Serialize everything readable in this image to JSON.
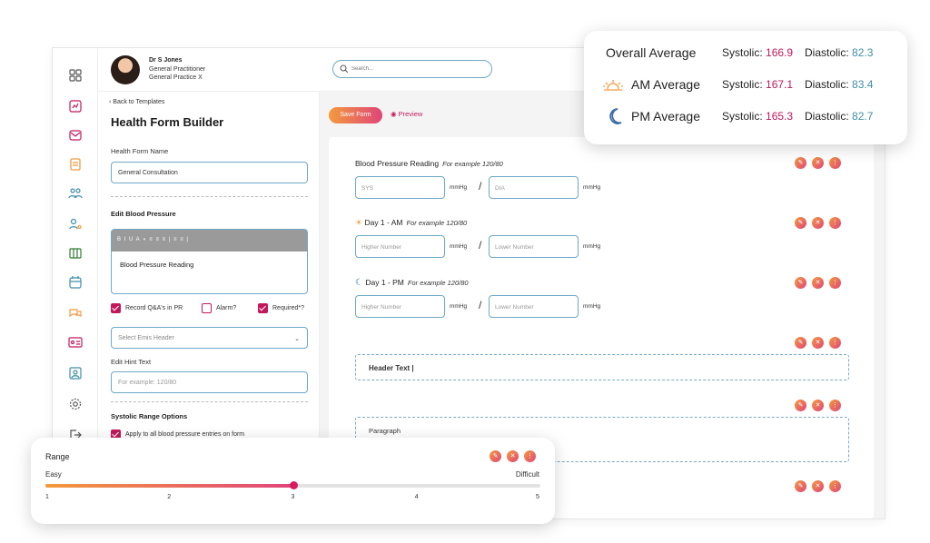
{
  "topbar": {
    "doctor_name": "Dr S Jones",
    "doctor_role": "General Practitioner",
    "doctor_practice": "General Practice X",
    "search_placeholder": "Search..."
  },
  "sidebar_icons": [
    "grid-icon",
    "chart-icon",
    "envelope-icon",
    "note-icon",
    "people-icon",
    "user-settings-icon",
    "columns-icon",
    "calendar-icon",
    "chat-icon",
    "id-card-icon",
    "contact-icon",
    "gear-icon",
    "logout-icon"
  ],
  "left_panel": {
    "back_link": "Back to Templates",
    "title": "Health Form Builder",
    "form_name_label": "Health Form Name",
    "form_name_value": "General Consultation",
    "edit_bp_label": "Edit Blood Pressure",
    "rte_toolbar": "B  I  U  A  ◖  ≡  ≡  ≡  |  ≡  ≡  |",
    "rte_text": "Blood Pressure Reading",
    "checkbox_record": "Record Q&A's in PR",
    "checkbox_alarm": "Alarm?",
    "checkbox_required": "Required*?",
    "emis_placeholder": "Select Emis Header",
    "hint_label": "Edit Hint Text",
    "hint_placeholder": "For example: 120/80",
    "systolic_label": "Systolic Range Options",
    "apply_all_label": "Apply to all blood pressure entries on form"
  },
  "toolbar": {
    "save_label": "Save Form",
    "preview_label": "Preview"
  },
  "canvas": {
    "bp_title": "Blood Pressure Reading",
    "bp_example": "For example 120/80",
    "sys_placeholder": "SYS",
    "dia_placeholder": "DIA",
    "unit": "mmHg",
    "slash": "/",
    "day_am_title": "Day 1 - AM",
    "day_pm_title": "Day 1 - PM",
    "higher_placeholder": "Higher Number",
    "lower_placeholder": "Lower Number",
    "header_text": "Header Text |",
    "paragraph_text": "Paragraph"
  },
  "averages": {
    "rows": [
      {
        "label": "Overall Average",
        "systolic_label": "Systolic:",
        "systolic": "166.9",
        "diastolic_label": "Diastolic:",
        "diastolic": "82.3"
      },
      {
        "label": "AM Average",
        "systolic_label": "Systolic:",
        "systolic": "167.1",
        "diastolic_label": "Diastolic:",
        "diastolic": "83.4"
      },
      {
        "label": "PM Average",
        "systolic_label": "Systolic:",
        "systolic": "165.3",
        "diastolic_label": "Diastolic:",
        "diastolic": "82.7"
      }
    ]
  },
  "range": {
    "title": "Range",
    "min_label": "Easy",
    "max_label": "Difficult",
    "ticks": [
      "1",
      "2",
      "3",
      "4",
      "5"
    ],
    "value": 3,
    "min": 1,
    "max": 5
  },
  "colors": {
    "accent_pink": "#c2185b",
    "accent_orange": "#f39a3c",
    "teal": "#3e8ea7",
    "field_border": "#6ea8c7"
  }
}
